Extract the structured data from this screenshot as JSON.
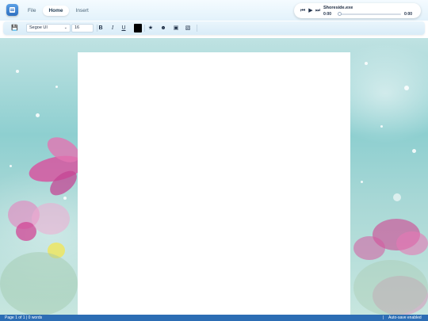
{
  "tabs": [
    {
      "label": "File",
      "active": false
    },
    {
      "label": "Home",
      "active": true
    },
    {
      "label": "Insert",
      "active": false
    }
  ],
  "player": {
    "track_title": "Shoreside.exe",
    "current_time": "0:00",
    "end_time": "0:00",
    "progress": 0
  },
  "toolbar": {
    "font_family_value": "Segoe UI",
    "font_size_value": "16",
    "bold_label": "B",
    "italic_label": "I",
    "underline_label": "U",
    "text_color": "#000000"
  },
  "status": {
    "left": "Page 1 of 1 | 0 words",
    "divider": "|",
    "right": "Auto-save enabled"
  },
  "colors": {
    "accent": "#2c6db4",
    "statusbar": "#2c6db4"
  }
}
